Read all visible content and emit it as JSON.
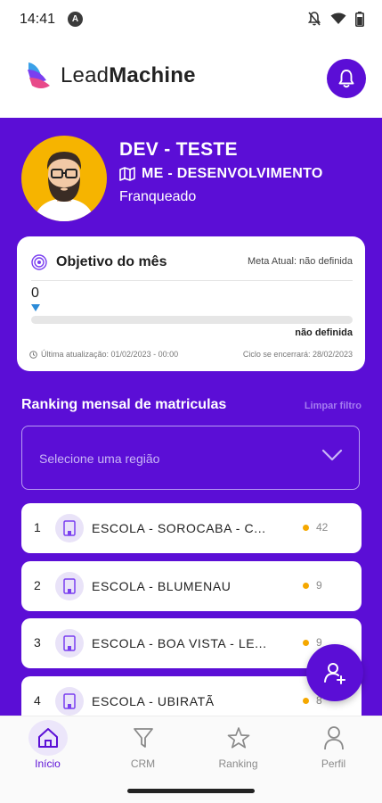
{
  "status_bar": {
    "time": "14:41",
    "badge": "A"
  },
  "header": {
    "logo_light": "Lead",
    "logo_bold": "Machine"
  },
  "profile": {
    "name": "DEV - TESTE",
    "unit": "ME - DESENVOLVIMENTO",
    "role": "Franqueado"
  },
  "goal": {
    "title": "Objetivo do mês",
    "meta_current": "Meta Atual: não definida",
    "value": "0",
    "target": "não definida",
    "last_update": "Última atualização: 01/02/2023 - 00:00",
    "cycle_end": "Ciclo se encerrará: 28/02/2023"
  },
  "ranking": {
    "title": "Ranking mensal de matriculas",
    "clear_filter": "Limpar filtro",
    "region_placeholder": "Selecione uma região",
    "items": [
      {
        "position": "1",
        "name": "ESCOLA - SOROCABA - C...",
        "score": "42"
      },
      {
        "position": "2",
        "name": "ESCOLA - BLUMENAU",
        "score": "9"
      },
      {
        "position": "3",
        "name": "ESCOLA - BOA VISTA - LE...",
        "score": "9"
      },
      {
        "position": "4",
        "name": "ESCOLA - UBIRATÃ",
        "score": "8"
      }
    ]
  },
  "bottom_nav": [
    {
      "label": "Início",
      "icon": "home-icon",
      "active": true
    },
    {
      "label": "CRM",
      "icon": "filter-icon",
      "active": false
    },
    {
      "label": "Ranking",
      "icon": "star-icon",
      "active": false
    },
    {
      "label": "Perfil",
      "icon": "user-icon",
      "active": false
    }
  ],
  "colors": {
    "primary": "#5b0ed6",
    "accent_dot": "#f5a800",
    "avatar_bg": "#f6b400"
  }
}
